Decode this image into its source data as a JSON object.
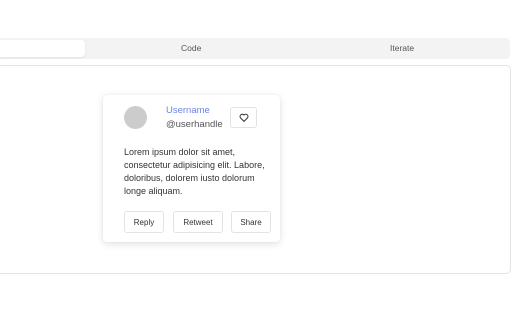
{
  "tabs": {
    "code_label": "Code",
    "iterate_label": "Iterate"
  },
  "card": {
    "username": "Username",
    "handle": "@userhandle",
    "body": "Lorem ipsum dolor sit amet, consectetur adipisicing elit. Labore, doloribus, dolorem iusto dolorum longe aliquam.",
    "like_icon": "heart-outline-icon",
    "buttons": {
      "reply": "Reply",
      "retweet": "Retweet",
      "share": "Share"
    }
  },
  "colors": {
    "username": "#6a86e8",
    "avatar": "#cccccc",
    "tab_bar": "#f3f3f3"
  }
}
